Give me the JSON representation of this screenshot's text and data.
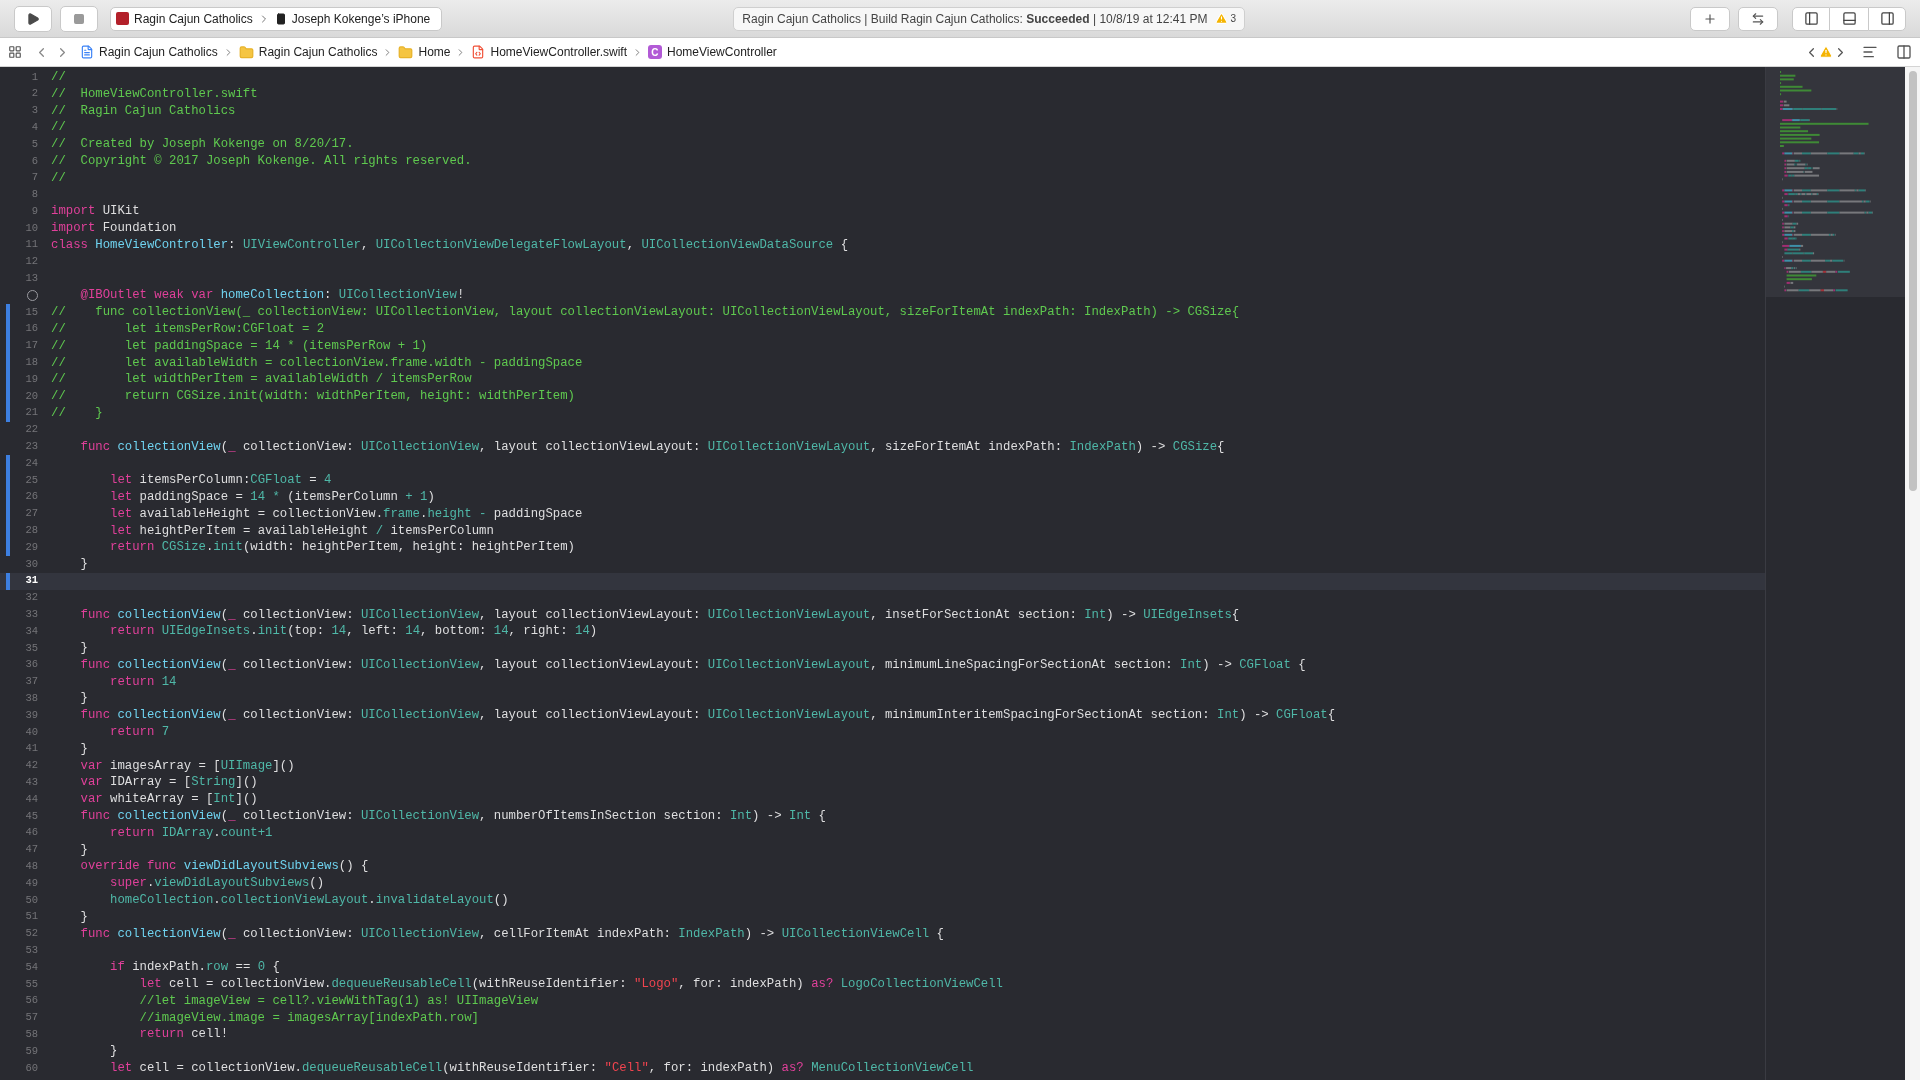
{
  "toolbar": {
    "scheme": "Ragin Cajun Catholics",
    "device": "Joseph Kokenge’s iPhone",
    "status": "Ragin Cajun Catholics | Build Ragin Cajun Catholics: **Succeeded** | 10/8/19 at 12:41 PM",
    "warning_count": "3"
  },
  "jump_bar": [
    {
      "kind": "project",
      "label": "Ragin Cajun Catholics"
    },
    {
      "kind": "folder",
      "label": "Ragin Cajun Catholics"
    },
    {
      "kind": "folder",
      "label": "Home"
    },
    {
      "kind": "swift",
      "label": "HomeViewController.swift"
    },
    {
      "kind": "class",
      "badge": "C",
      "label": "HomeViewController"
    }
  ],
  "lines": [
    {
      "number": "1",
      "changed": false,
      "current": false,
      "tokens": [
        {
          "kind": "comment",
          "text": "//"
        }
      ]
    },
    {
      "number": "2",
      "changed": false,
      "current": false,
      "tokens": [
        {
          "kind": "comment",
          "text": "//  HomeViewController.swift"
        }
      ]
    },
    {
      "number": "3",
      "changed": false,
      "current": false,
      "tokens": [
        {
          "kind": "comment",
          "text": "//  Ragin Cajun Catholics"
        }
      ]
    },
    {
      "number": "4",
      "changed": false,
      "current": false,
      "tokens": [
        {
          "kind": "comment",
          "text": "//"
        }
      ]
    },
    {
      "number": "5",
      "changed": false,
      "current": false,
      "tokens": [
        {
          "kind": "comment",
          "text": "//  Created by Joseph Kokenge on 8/20/17."
        }
      ]
    },
    {
      "number": "6",
      "changed": false,
      "current": false,
      "tokens": [
        {
          "kind": "comment",
          "text": "//  Copyright © 2017 Joseph Kokenge. All rights reserved."
        }
      ]
    },
    {
      "number": "7",
      "changed": false,
      "current": false,
      "tokens": [
        {
          "kind": "comment",
          "text": "//"
        }
      ]
    },
    {
      "number": "8",
      "changed": false,
      "current": false
    },
    {
      "number": "9",
      "changed": false,
      "current": false,
      "tokens": [
        {
          "kind": "keyword",
          "text": "import"
        },
        {
          "kind": "plain",
          "text": " UIKit"
        }
      ]
    },
    {
      "number": "10",
      "changed": false,
      "current": false,
      "tokens": [
        {
          "kind": "keyword",
          "text": "import"
        },
        {
          "kind": "plain",
          "text": " Foundation"
        }
      ]
    },
    {
      "number": "11",
      "changed": false,
      "current": false,
      "tokens": [
        {
          "kind": "keyword",
          "text": "class "
        },
        {
          "kind": "decl",
          "text": "HomeViewController"
        },
        {
          "kind": "plain",
          "text": ": "
        },
        {
          "kind": "type",
          "text": "UIViewController"
        },
        {
          "kind": "plain",
          "text": ", "
        },
        {
          "kind": "type",
          "text": "UICollectionViewDelegateFlowLayout"
        },
        {
          "kind": "plain",
          "text": ", "
        },
        {
          "kind": "type",
          "text": "UICollectionViewDataSource"
        },
        {
          "kind": "plain",
          "text": " {"
        }
      ]
    },
    {
      "number": "12",
      "changed": false,
      "current": false
    },
    {
      "number": "13",
      "changed": false,
      "current": false
    },
    {
      "outlet": {
        "connected": false
      },
      "changed": false,
      "current": false,
      "tokens": [
        {
          "kind": "keyword",
          "text": "    @IBOutlet weak var "
        },
        {
          "kind": "decl",
          "text": "homeCollection"
        },
        {
          "kind": "plain",
          "text": ": "
        },
        {
          "kind": "type",
          "text": "UICollectionView"
        },
        {
          "kind": "plain",
          "text": "!"
        }
      ]
    },
    {
      "number": "15",
      "changed": true,
      "current": false,
      "tokens": [
        {
          "kind": "comment",
          "text": "//    func collectionView(_ collectionView: UICollectionView, layout collectionViewLayout: UICollectionViewLayout, sizeForItemAt indexPath: IndexPath) -> CGSize{"
        }
      ]
    },
    {
      "number": "16",
      "changed": true,
      "current": false,
      "tokens": [
        {
          "kind": "comment",
          "text": "//        let itemsPerRow:CGFloat = 2"
        }
      ]
    },
    {
      "number": "17",
      "changed": true,
      "current": false,
      "tokens": [
        {
          "kind": "comment",
          "text": "//        let paddingSpace = 14 * (itemsPerRow + 1)"
        }
      ]
    },
    {
      "number": "18",
      "changed": true,
      "current": false,
      "tokens": [
        {
          "kind": "comment",
          "text": "//        let availableWidth = collectionView.frame.width - paddingSpace"
        }
      ]
    },
    {
      "number": "19",
      "changed": true,
      "current": false,
      "tokens": [
        {
          "kind": "comment",
          "text": "//        let widthPerItem = availableWidth / itemsPerRow"
        }
      ]
    },
    {
      "number": "20",
      "changed": true,
      "current": false,
      "tokens": [
        {
          "kind": "comment",
          "text": "//        return CGSize.init(width: widthPerItem, height: widthPerItem)"
        }
      ]
    },
    {
      "number": "21",
      "changed": true,
      "current": false,
      "tokens": [
        {
          "kind": "comment",
          "text": "//    }"
        }
      ]
    },
    {
      "number": "22",
      "changed": false,
      "current": false
    },
    {
      "number": "23",
      "changed": false,
      "current": false,
      "tokens": [
        {
          "kind": "keyword",
          "text": "    func "
        },
        {
          "kind": "decl",
          "text": "collectionView"
        },
        {
          "kind": "plain",
          "text": "("
        },
        {
          "kind": "keyword",
          "text": "_"
        },
        {
          "kind": "plain",
          "text": " collectionView: "
        },
        {
          "kind": "type",
          "text": "UICollectionView"
        },
        {
          "kind": "plain",
          "text": ", layout collectionViewLayout: "
        },
        {
          "kind": "type",
          "text": "UICollectionViewLayout"
        },
        {
          "kind": "plain",
          "text": ", sizeForItemAt indexPath: "
        },
        {
          "kind": "type",
          "text": "IndexPath"
        },
        {
          "kind": "plain",
          "text": ") -> "
        },
        {
          "kind": "type",
          "text": "CGSize"
        },
        {
          "kind": "plain",
          "text": "{"
        }
      ]
    },
    {
      "number": "24",
      "changed": true,
      "current": false
    },
    {
      "number": "25",
      "changed": true,
      "current": false,
      "tokens": [
        {
          "kind": "keyword",
          "text": "        let"
        },
        {
          "kind": "plain",
          "text": " itemsPerColumn:"
        },
        {
          "kind": "type",
          "text": "CGFloat"
        },
        {
          "kind": "plain",
          "text": " = "
        },
        {
          "kind": "number",
          "text": "4"
        }
      ]
    },
    {
      "number": "26",
      "changed": true,
      "current": false,
      "tokens": [
        {
          "kind": "keyword",
          "text": "        let"
        },
        {
          "kind": "plain",
          "text": " paddingSpace = "
        },
        {
          "kind": "number",
          "text": "14"
        },
        {
          "kind": "operator",
          "text": " *"
        },
        {
          "kind": "plain",
          "text": " (itemsPerColumn "
        },
        {
          "kind": "operator",
          "text": "+"
        },
        {
          "kind": "number",
          "text": " 1"
        },
        {
          "kind": "plain",
          "text": ")"
        }
      ]
    },
    {
      "number": "27",
      "changed": true,
      "current": false,
      "tokens": [
        {
          "kind": "keyword",
          "text": "        let"
        },
        {
          "kind": "plain",
          "text": " availableHeight = collectionView."
        },
        {
          "kind": "type",
          "text": "frame"
        },
        {
          "kind": "plain",
          "text": "."
        },
        {
          "kind": "type",
          "text": "height"
        },
        {
          "kind": "operator",
          "text": " -"
        },
        {
          "kind": "plain",
          "text": " paddingSpace"
        }
      ]
    },
    {
      "number": "28",
      "changed": true,
      "current": false,
      "tokens": [
        {
          "kind": "keyword",
          "text": "        let"
        },
        {
          "kind": "plain",
          "text": " heightPerItem = availableHeight "
        },
        {
          "kind": "operator",
          "text": "/"
        },
        {
          "kind": "plain",
          "text": " itemsPerColumn"
        }
      ]
    },
    {
      "number": "29",
      "changed": true,
      "current": false,
      "tokens": [
        {
          "kind": "keyword",
          "text": "        return"
        },
        {
          "kind": "type",
          "text": " CGSize"
        },
        {
          "kind": "plain",
          "text": "."
        },
        {
          "kind": "type",
          "text": "init"
        },
        {
          "kind": "plain",
          "text": "(width: heightPerItem, height: heightPerItem)"
        }
      ]
    },
    {
      "number": "30",
      "changed": false,
      "current": false,
      "tokens": [
        {
          "kind": "plain",
          "text": "    }"
        }
      ]
    },
    {
      "number": "31",
      "changed": true,
      "current": true
    },
    {
      "number": "32",
      "changed": false,
      "current": false
    },
    {
      "number": "33",
      "changed": false,
      "current": false,
      "tokens": [
        {
          "kind": "keyword",
          "text": "    func "
        },
        {
          "kind": "decl",
          "text": "collectionView"
        },
        {
          "kind": "plain",
          "text": "("
        },
        {
          "kind": "keyword",
          "text": "_"
        },
        {
          "kind": "plain",
          "text": " collectionView: "
        },
        {
          "kind": "type",
          "text": "UICollectionView"
        },
        {
          "kind": "plain",
          "text": ", layout collectionViewLayout: "
        },
        {
          "kind": "type",
          "text": "UICollectionViewLayout"
        },
        {
          "kind": "plain",
          "text": ", insetForSectionAt section: "
        },
        {
          "kind": "type",
          "text": "Int"
        },
        {
          "kind": "plain",
          "text": ") -> "
        },
        {
          "kind": "type",
          "text": "UIEdgeInsets"
        },
        {
          "kind": "plain",
          "text": "{"
        }
      ]
    },
    {
      "number": "34",
      "changed": false,
      "current": false,
      "tokens": [
        {
          "kind": "keyword",
          "text": "        return"
        },
        {
          "kind": "type",
          "text": " UIEdgeInsets"
        },
        {
          "kind": "plain",
          "text": "."
        },
        {
          "kind": "type",
          "text": "init"
        },
        {
          "kind": "plain",
          "text": "(top: "
        },
        {
          "kind": "number",
          "text": "14"
        },
        {
          "kind": "plain",
          "text": ", left: "
        },
        {
          "kind": "number",
          "text": "14"
        },
        {
          "kind": "plain",
          "text": ", bottom: "
        },
        {
          "kind": "number",
          "text": "14"
        },
        {
          "kind": "plain",
          "text": ", right: "
        },
        {
          "kind": "number",
          "text": "14"
        },
        {
          "kind": "plain",
          "text": ")"
        }
      ]
    },
    {
      "number": "35",
      "changed": false,
      "current": false,
      "tokens": [
        {
          "kind": "plain",
          "text": "    }"
        }
      ]
    },
    {
      "number": "36",
      "changed": false,
      "current": false,
      "tokens": [
        {
          "kind": "keyword",
          "text": "    func "
        },
        {
          "kind": "decl",
          "text": "collectionView"
        },
        {
          "kind": "plain",
          "text": "("
        },
        {
          "kind": "keyword",
          "text": "_"
        },
        {
          "kind": "plain",
          "text": " collectionView: "
        },
        {
          "kind": "type",
          "text": "UICollectionView"
        },
        {
          "kind": "plain",
          "text": ", layout collectionViewLayout: "
        },
        {
          "kind": "type",
          "text": "UICollectionViewLayout"
        },
        {
          "kind": "plain",
          "text": ", minimumLineSpacingForSectionAt section: "
        },
        {
          "kind": "type",
          "text": "Int"
        },
        {
          "kind": "plain",
          "text": ") -> "
        },
        {
          "kind": "type",
          "text": "CGFloat"
        },
        {
          "kind": "plain",
          "text": " {"
        }
      ]
    },
    {
      "number": "37",
      "changed": false,
      "current": false,
      "tokens": [
        {
          "kind": "keyword",
          "text": "        return"
        },
        {
          "kind": "number",
          "text": " 14"
        }
      ]
    },
    {
      "number": "38",
      "changed": false,
      "current": false,
      "tokens": [
        {
          "kind": "plain",
          "text": "    }"
        }
      ]
    },
    {
      "number": "39",
      "changed": false,
      "current": false,
      "tokens": [
        {
          "kind": "keyword",
          "text": "    func "
        },
        {
          "kind": "decl",
          "text": "collectionView"
        },
        {
          "kind": "plain",
          "text": "("
        },
        {
          "kind": "keyword",
          "text": "_"
        },
        {
          "kind": "plain",
          "text": " collectionView: "
        },
        {
          "kind": "type",
          "text": "UICollectionView"
        },
        {
          "kind": "plain",
          "text": ", layout collectionViewLayout: "
        },
        {
          "kind": "type",
          "text": "UICollectionViewLayout"
        },
        {
          "kind": "plain",
          "text": ", minimumInteritemSpacingForSectionAt section: "
        },
        {
          "kind": "type",
          "text": "Int"
        },
        {
          "kind": "plain",
          "text": ") -> "
        },
        {
          "kind": "type",
          "text": "CGFloat"
        },
        {
          "kind": "plain",
          "text": "{"
        }
      ]
    },
    {
      "number": "40",
      "changed": false,
      "current": false,
      "tokens": [
        {
          "kind": "keyword",
          "text": "        return"
        },
        {
          "kind": "number",
          "text": " 7"
        }
      ]
    },
    {
      "number": "41",
      "changed": false,
      "current": false,
      "tokens": [
        {
          "kind": "plain",
          "text": "    }"
        }
      ]
    },
    {
      "number": "42",
      "changed": false,
      "current": false,
      "tokens": [
        {
          "kind": "keyword",
          "text": "    var"
        },
        {
          "kind": "plain",
          "text": " imagesArray = ["
        },
        {
          "kind": "type",
          "text": "UIImage"
        },
        {
          "kind": "plain",
          "text": "]()"
        }
      ]
    },
    {
      "number": "43",
      "changed": false,
      "current": false,
      "tokens": [
        {
          "kind": "keyword",
          "text": "    var"
        },
        {
          "kind": "plain",
          "text": " IDArray = ["
        },
        {
          "kind": "type",
          "text": "String"
        },
        {
          "kind": "plain",
          "text": "]()"
        }
      ]
    },
    {
      "number": "44",
      "changed": false,
      "current": false,
      "tokens": [
        {
          "kind": "keyword",
          "text": "    var"
        },
        {
          "kind": "plain",
          "text": " whiteArray = ["
        },
        {
          "kind": "type",
          "text": "Int"
        },
        {
          "kind": "plain",
          "text": "]()"
        }
      ]
    },
    {
      "number": "45",
      "changed": false,
      "current": false,
      "tokens": [
        {
          "kind": "keyword",
          "text": "    func "
        },
        {
          "kind": "decl",
          "text": "collectionView"
        },
        {
          "kind": "plain",
          "text": "("
        },
        {
          "kind": "keyword",
          "text": "_"
        },
        {
          "kind": "plain",
          "text": " collectionView: "
        },
        {
          "kind": "type",
          "text": "UICollectionView"
        },
        {
          "kind": "plain",
          "text": ", numberOfItemsInSection section: "
        },
        {
          "kind": "type",
          "text": "Int"
        },
        {
          "kind": "plain",
          "text": ") -> "
        },
        {
          "kind": "type",
          "text": "Int"
        },
        {
          "kind": "plain",
          "text": " {"
        }
      ]
    },
    {
      "number": "46",
      "changed": false,
      "current": false,
      "tokens": [
        {
          "kind": "keyword",
          "text": "        return"
        },
        {
          "kind": "type",
          "text": " IDArray"
        },
        {
          "kind": "plain",
          "text": "."
        },
        {
          "kind": "type",
          "text": "count"
        },
        {
          "kind": "operator",
          "text": "+"
        },
        {
          "kind": "number",
          "text": "1"
        }
      ]
    },
    {
      "number": "47",
      "changed": false,
      "current": false,
      "tokens": [
        {
          "kind": "plain",
          "text": "    }"
        }
      ]
    },
    {
      "number": "48",
      "changed": false,
      "current": false,
      "tokens": [
        {
          "kind": "keyword",
          "text": "    override func "
        },
        {
          "kind": "decl",
          "text": "viewDidLayoutSubviews"
        },
        {
          "kind": "plain",
          "text": "() {"
        }
      ]
    },
    {
      "number": "49",
      "changed": false,
      "current": false,
      "tokens": [
        {
          "kind": "keyword",
          "text": "        super"
        },
        {
          "kind": "plain",
          "text": "."
        },
        {
          "kind": "type",
          "text": "viewDidLayoutSubviews"
        },
        {
          "kind": "plain",
          "text": "()"
        }
      ]
    },
    {
      "number": "50",
      "changed": false,
      "current": false,
      "tokens": [
        {
          "kind": "type",
          "text": "        homeCollection"
        },
        {
          "kind": "plain",
          "text": "."
        },
        {
          "kind": "type",
          "text": "collectionViewLayout"
        },
        {
          "kind": "plain",
          "text": "."
        },
        {
          "kind": "type",
          "text": "invalidateLayout"
        },
        {
          "kind": "plain",
          "text": "()"
        }
      ]
    },
    {
      "number": "51",
      "changed": false,
      "current": false,
      "tokens": [
        {
          "kind": "plain",
          "text": "    }"
        }
      ]
    },
    {
      "number": "52",
      "changed": false,
      "current": false,
      "tokens": [
        {
          "kind": "keyword",
          "text": "    func "
        },
        {
          "kind": "decl",
          "text": "collectionView"
        },
        {
          "kind": "plain",
          "text": "("
        },
        {
          "kind": "keyword",
          "text": "_"
        },
        {
          "kind": "plain",
          "text": " collectionView: "
        },
        {
          "kind": "type",
          "text": "UICollectionView"
        },
        {
          "kind": "plain",
          "text": ", cellForItemAt indexPath: "
        },
        {
          "kind": "type",
          "text": "IndexPath"
        },
        {
          "kind": "plain",
          "text": ") -> "
        },
        {
          "kind": "type",
          "text": "UICollectionViewCell"
        },
        {
          "kind": "plain",
          "text": " {"
        }
      ]
    },
    {
      "number": "53",
      "changed": false,
      "current": false
    },
    {
      "number": "54",
      "changed": false,
      "current": false,
      "tokens": [
        {
          "kind": "keyword",
          "text": "        if"
        },
        {
          "kind": "plain",
          "text": " indexPath."
        },
        {
          "kind": "type",
          "text": "row"
        },
        {
          "kind": "plain",
          "text": " == "
        },
        {
          "kind": "number",
          "text": "0"
        },
        {
          "kind": "plain",
          "text": " {"
        }
      ]
    },
    {
      "number": "55",
      "changed": false,
      "current": false,
      "tokens": [
        {
          "kind": "keyword",
          "text": "            let"
        },
        {
          "kind": "plain",
          "text": " cell = collectionView."
        },
        {
          "kind": "type",
          "text": "dequeueReusableCell"
        },
        {
          "kind": "plain",
          "text": "(withReuseIdentifier: "
        },
        {
          "kind": "string",
          "text": "\"Logo\""
        },
        {
          "kind": "plain",
          "text": ", for: indexPath) "
        },
        {
          "kind": "keyword",
          "text": "as?"
        },
        {
          "kind": "type",
          "text": " LogoCollectionViewCell"
        }
      ]
    },
    {
      "number": "56",
      "changed": false,
      "current": false,
      "tokens": [
        {
          "kind": "comment",
          "text": "            //let imageView = cell?.viewWithTag(1) as! UIImageView"
        }
      ]
    },
    {
      "number": "57",
      "changed": false,
      "current": false,
      "tokens": [
        {
          "kind": "comment",
          "text": "            //imageView.image = imagesArray[indexPath.row]"
        }
      ]
    },
    {
      "number": "58",
      "changed": false,
      "current": false,
      "tokens": [
        {
          "kind": "keyword",
          "text": "            return"
        },
        {
          "kind": "plain",
          "text": " cell!"
        }
      ]
    },
    {
      "number": "59",
      "changed": false,
      "current": false,
      "tokens": [
        {
          "kind": "plain",
          "text": "        }"
        }
      ]
    },
    {
      "number": "60",
      "changed": false,
      "current": false,
      "tokens": [
        {
          "kind": "keyword",
          "text": "        let"
        },
        {
          "kind": "plain",
          "text": " cell = collectionView."
        },
        {
          "kind": "type",
          "text": "dequeueReusableCell"
        },
        {
          "kind": "plain",
          "text": "(withReuseIdentifier: "
        },
        {
          "kind": "string",
          "text": "\"Cell\""
        },
        {
          "kind": "plain",
          "text": ", for: indexPath) "
        },
        {
          "kind": "keyword",
          "text": "as?"
        },
        {
          "kind": "type",
          "text": " MenuCollectionViewCell"
        }
      ]
    }
  ]
}
